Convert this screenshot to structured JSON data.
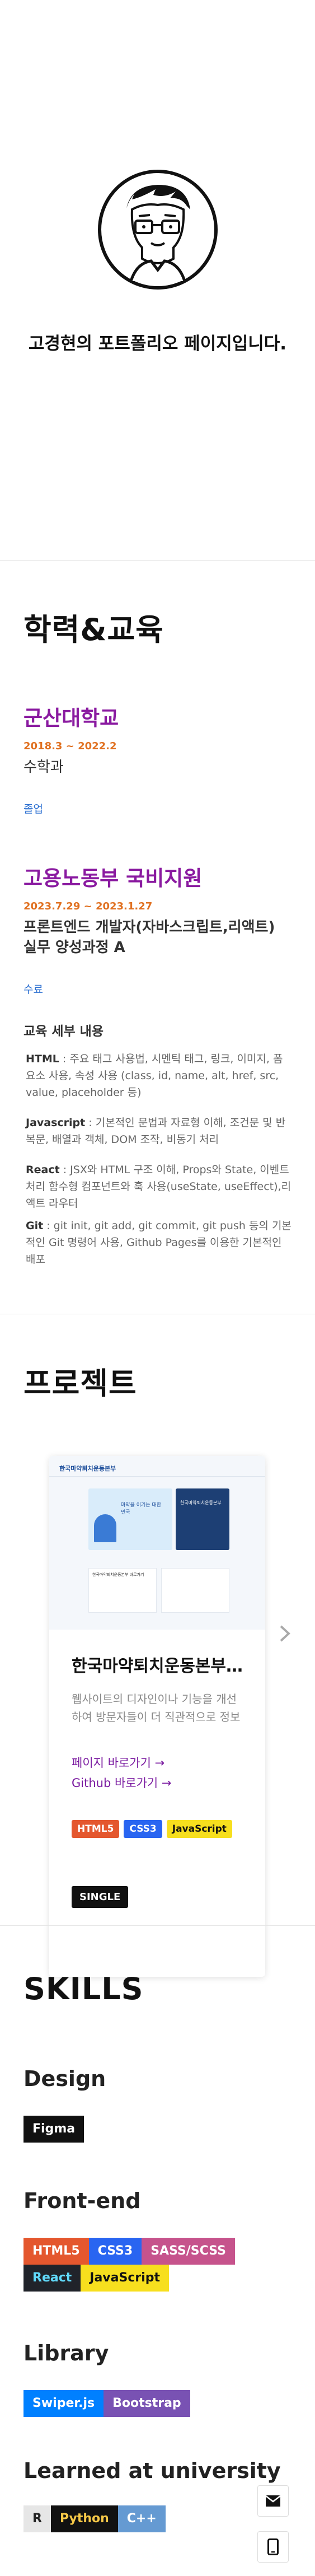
{
  "hero": {
    "title": "고경현의 포트폴리오 페이지입니다."
  },
  "education": {
    "heading": "학력&교육",
    "entries": [
      {
        "school": "군산대학교",
        "period": "2018.3 ~ 2022.2",
        "major": "수학과",
        "status": "졸업"
      },
      {
        "school": "고용노동부 국비지원",
        "period": "2023.7.29 ~ 2023.1.27",
        "major": "프론트엔드 개발자(자바스크립트,리액트) 실무 양성과정 A",
        "status": "수료"
      }
    ],
    "details_heading": "교육 세부 내용",
    "details": [
      {
        "key": "HTML",
        "text": " : 주요 태그 사용법, 시멘틱 태그, 링크, 이미지, 폼 요소 사용, 속성 사용 (class, id, name, alt, href, src, value, placeholder 등)"
      },
      {
        "key": "Javascript",
        "text": " : 기본적인 문법과 자료형 이해, 조건문 및 반복문, 배열과 객체, DOM 조작, 비동기 처리"
      },
      {
        "key": "React",
        "text": " : JSX와 HTML 구조 이해, Props와 State, 이벤트 처리 함수형 컴포넌트와 훅 사용(useState, useEffect),리액트 라우터"
      },
      {
        "key": "Git",
        "text": " : git init, git add, git commit, git push 등의 기본적인 Git 명령어 사용, Github Pages를 이용한 기본적인 배포"
      }
    ]
  },
  "projects": {
    "heading": "프로젝트",
    "card": {
      "title": "한국마약퇴치운동본부 웹사이트 리뉴얼",
      "description": "웹사이트의 디자인이나 기능을 개선하여 방문자들이 더 직관적으로 정보를 얻을 수 있도록",
      "link_page": "페이지 바로가기 →",
      "link_github": "Github 바로가기 →",
      "tags": [
        {
          "label": "HTML5",
          "bg": "#e4572e",
          "fg": "#ffffff"
        },
        {
          "label": "CSS3",
          "bg": "#2965f1",
          "fg": "#ffffff"
        },
        {
          "label": "JavaScript",
          "bg": "#f7df1e",
          "fg": "#111111"
        }
      ],
      "badge": "SINGLE",
      "preview": {
        "site_name": "한국마약퇴치운동본부",
        "banner_left": "마약을 이기는 대한민국",
        "banner_right": "한국마약퇴치운동본부",
        "notice": "한국마약퇴치운동본부 바로가기"
      }
    }
  },
  "skills": {
    "heading": "SKILLS",
    "groups": [
      {
        "name": "Design",
        "items": [
          {
            "label": "Figma",
            "bg": "#111111",
            "fg": "#ffffff"
          }
        ]
      },
      {
        "name": "Front-end",
        "items": [
          {
            "label": "HTML5",
            "bg": "#e4572e",
            "fg": "#ffffff"
          },
          {
            "label": "CSS3",
            "bg": "#2965f1",
            "fg": "#ffffff"
          },
          {
            "label": "SASS/SCSS",
            "bg": "#c6538c",
            "fg": "#ffffff"
          },
          {
            "label": "React",
            "bg": "#20232a",
            "fg": "#61dafb"
          },
          {
            "label": "JavaScript",
            "bg": "#f7df1e",
            "fg": "#111111"
          }
        ]
      },
      {
        "name": "Library",
        "items": [
          {
            "label": "Swiper.js",
            "bg": "#0080ff",
            "fg": "#ffffff"
          },
          {
            "label": "Bootstrap",
            "bg": "#7952b3",
            "fg": "#ffffff"
          }
        ]
      },
      {
        "name": "Learned at university",
        "items": [
          {
            "label": "R",
            "bg": "#e6e6e6",
            "fg": "#222222"
          },
          {
            "label": "Python",
            "bg": "#111111",
            "fg": "#f7c948"
          },
          {
            "label": "C++",
            "bg": "#659ad2",
            "fg": "#ffffff"
          }
        ]
      }
    ]
  },
  "floating": {
    "mail_icon": "mail-icon",
    "phone_icon": "phone-icon"
  }
}
